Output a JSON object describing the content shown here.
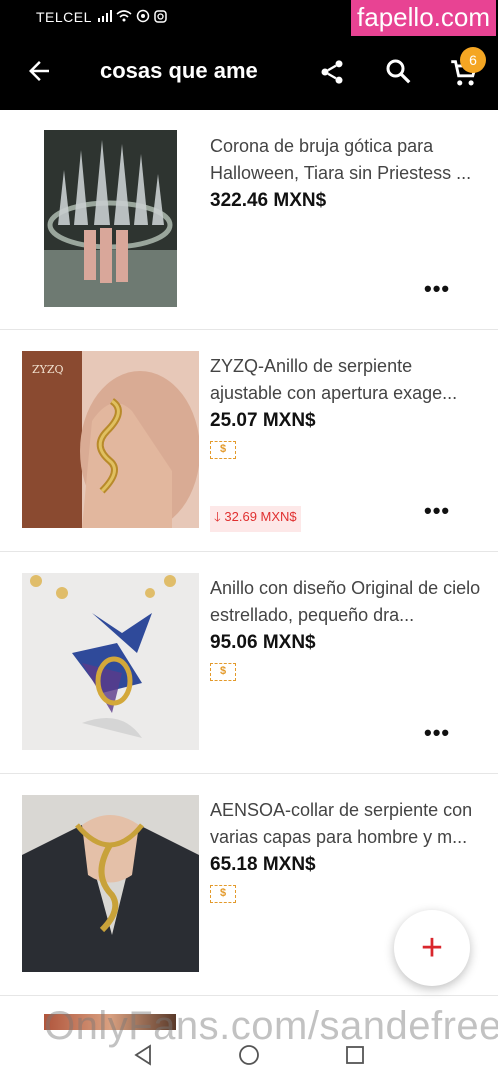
{
  "status": {
    "carrier": "TELCEL",
    "icons": [
      "signal-icon",
      "wifi-icon",
      "whatsapp-icon",
      "instagram-icon"
    ]
  },
  "watermarks": {
    "top": "fapello.com",
    "bottom": "OnlyFans.com/sandefree"
  },
  "appbar": {
    "title": "cosas que ame",
    "cart_count": "6"
  },
  "items": [
    {
      "name": "Corona de bruja gótica para Halloween, Tiara sin Priestess ...",
      "price": "322.46 MXN$",
      "coupon": "",
      "drop": ""
    },
    {
      "name": "ZYZQ-Anillo de serpiente ajustable con apertura exage...",
      "price": "25.07 MXN$",
      "coupon": "$",
      "drop": "32.69 MXN$",
      "brand_mark": "ZYZQ"
    },
    {
      "name": "Anillo con diseño Original de cielo estrellado, pequeño dra...",
      "price": "95.06 MXN$",
      "coupon": "$",
      "drop": ""
    },
    {
      "name": "AENSOA-collar de serpiente con varias capas para hombre y m...",
      "price": "65.18 MXN$",
      "coupon": "$",
      "drop": ""
    }
  ],
  "more_label": "•••",
  "fab_label": "+",
  "colors": {
    "accent": "#d9262c",
    "coupon": "#e39a2b",
    "badge": "#f5a623"
  }
}
